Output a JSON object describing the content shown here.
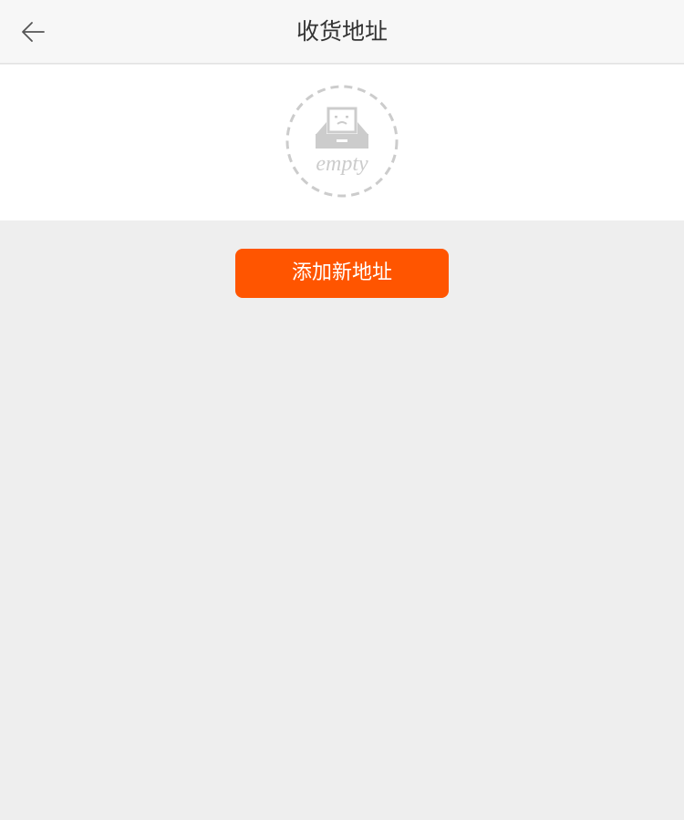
{
  "header": {
    "title": "收货地址",
    "back_icon": "back-arrow-icon"
  },
  "empty_state": {
    "icon": "empty-tray-icon",
    "text": "empty",
    "colors": {
      "icon": "#cccccc",
      "background": "#ffffff"
    }
  },
  "actions": {
    "add_address_label": "添加新地址"
  },
  "colors": {
    "accent": "#ff5500",
    "page_background": "#eeeeee",
    "header_background": "#f7f7f7"
  }
}
